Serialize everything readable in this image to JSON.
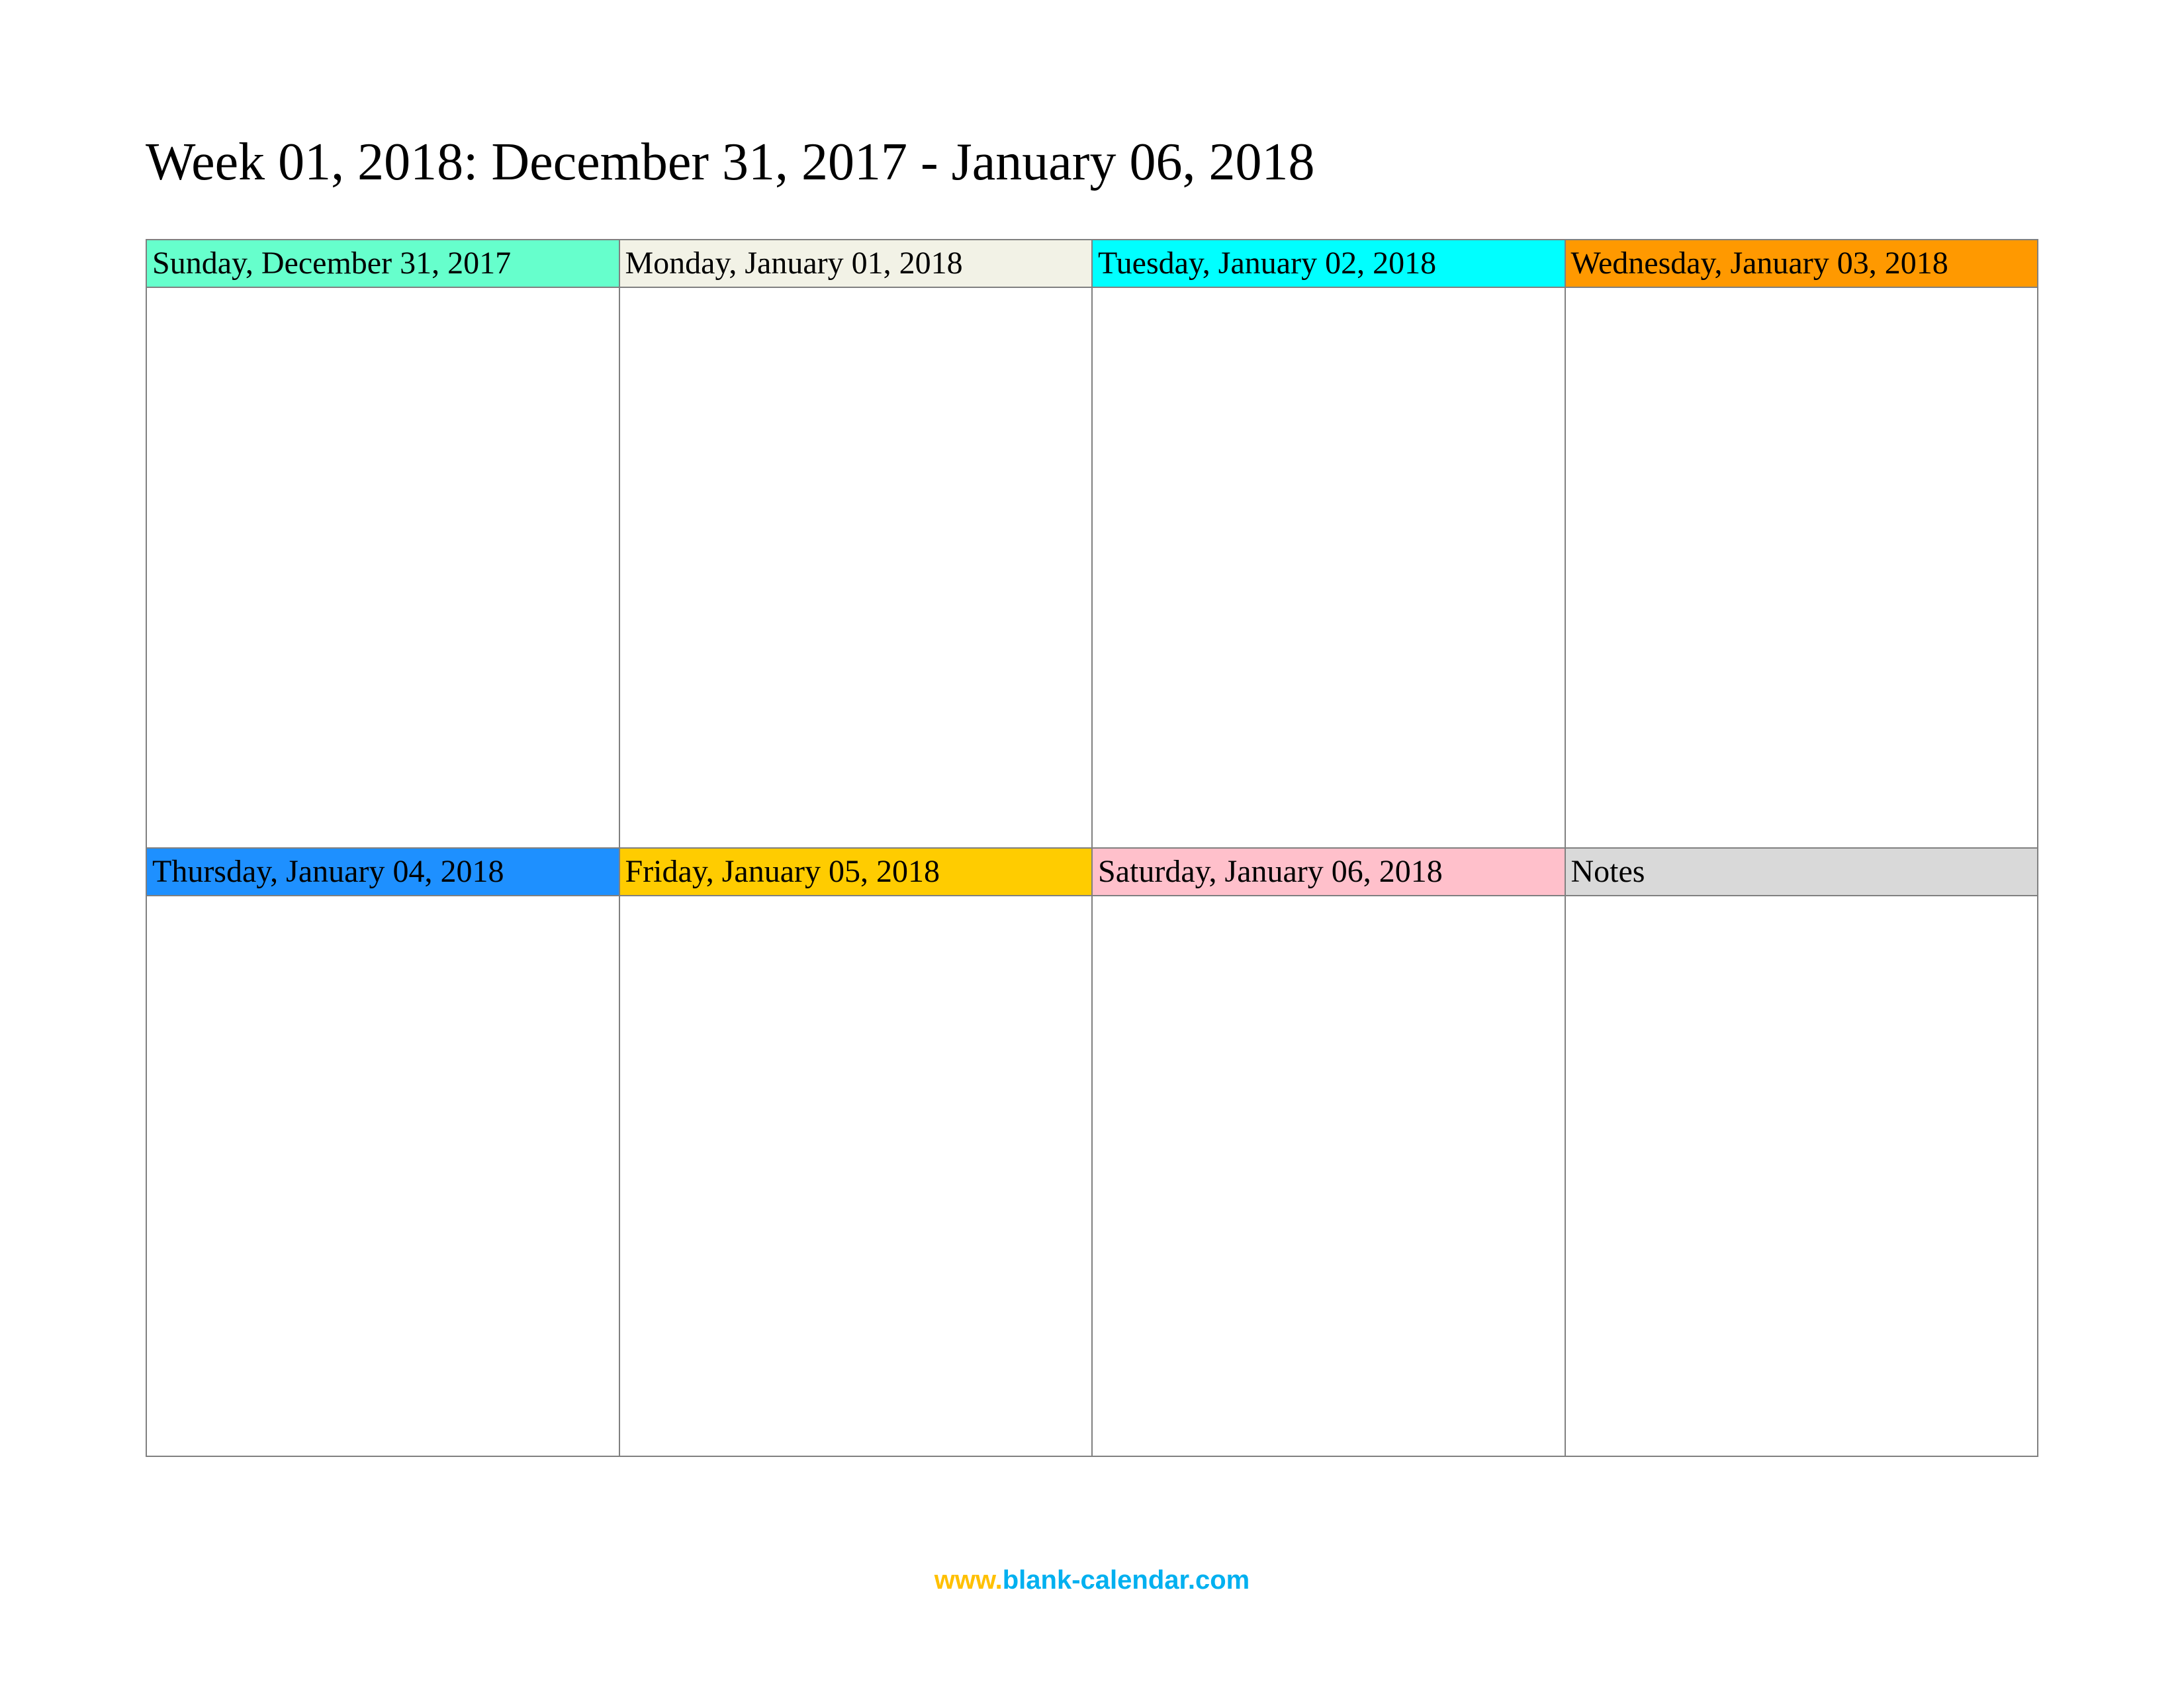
{
  "title": "Week 01, 2018: December 31, 2017 - January 06, 2018",
  "cells": [
    {
      "label": "Sunday, December 31, 2017",
      "bg": "#66ffcc"
    },
    {
      "label": "Monday, January 01, 2018",
      "bg": "#f2f2e6"
    },
    {
      "label": "Tuesday, January 02, 2018",
      "bg": "#00ffff"
    },
    {
      "label": "Wednesday, January 03, 2018",
      "bg": "#ff9900"
    },
    {
      "label": "Thursday, January 04, 2018",
      "bg": "#1e90ff"
    },
    {
      "label": "Friday, January 05, 2018",
      "bg": "#ffcc00"
    },
    {
      "label": "Saturday, January 06, 2018",
      "bg": "#ffc0cb"
    },
    {
      "label": "Notes",
      "bg": "#d9d9d9"
    }
  ],
  "footer": {
    "www": "www.",
    "domain": "blank-calendar.com"
  }
}
